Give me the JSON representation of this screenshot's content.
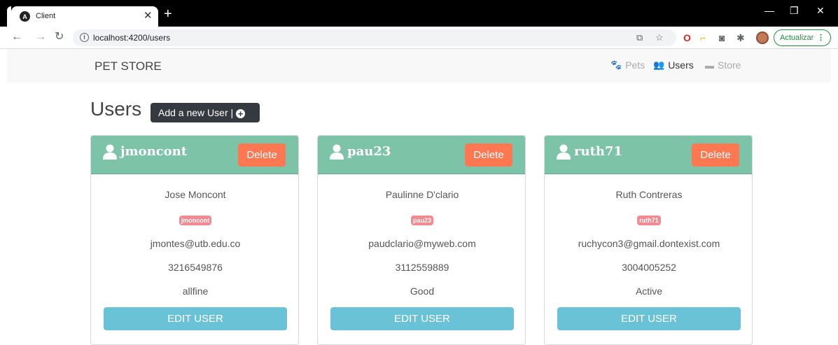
{
  "browser": {
    "tab_title": "Client",
    "tab_favicon_letter": "A",
    "url": "localhost:4200/users",
    "update_label": "Actualizar"
  },
  "navbar": {
    "brand": "PET STORE",
    "links": [
      {
        "label": "Pets",
        "icon": "paw-icon",
        "active": false
      },
      {
        "label": "Users",
        "icon": "users-icon",
        "active": true
      },
      {
        "label": "Store",
        "icon": "store-icon",
        "active": false
      }
    ]
  },
  "page": {
    "title": "Users",
    "add_button_label": "Add a new User |"
  },
  "cards": [
    {
      "username": "jmoncont",
      "full_name": "Jose Moncont",
      "email": "jmontes@utb.edu.co",
      "phone": "3216549876",
      "status": "allfine",
      "delete_label": "Delete",
      "edit_label": "EDIT USER"
    },
    {
      "username": "pau23",
      "full_name": "Paulinne D'clario",
      "email": "paudclario@myweb.com",
      "phone": "3112559889",
      "status": "Good",
      "delete_label": "Delete",
      "edit_label": "EDIT USER"
    },
    {
      "username": "ruth71",
      "full_name": "Ruth Contreras",
      "email": "ruchycon3@gmail.dontexist.com",
      "phone": "3004005252",
      "status": "Active",
      "delete_label": "Delete",
      "edit_label": "EDIT USER"
    }
  ],
  "colors": {
    "card_header": "#7dc3a8",
    "delete": "#ff7852",
    "edit": "#6ac2d6",
    "badge": "#f28a8f",
    "add_button": "#343a40"
  }
}
